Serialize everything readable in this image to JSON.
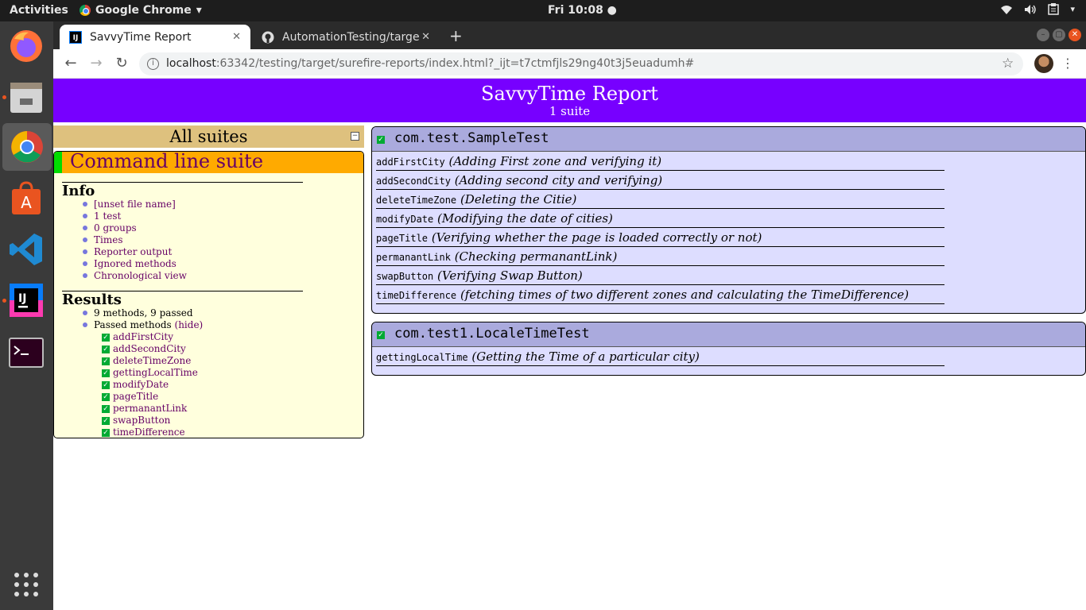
{
  "topbar": {
    "activities": "Activities",
    "app_name": "Google Chrome",
    "clock": "Fri 10:08 ●"
  },
  "dock": {
    "items": [
      "firefox",
      "files",
      "chrome",
      "software-center",
      "vscode",
      "intellij",
      "terminal",
      "show-apps"
    ]
  },
  "browser": {
    "tabs": [
      {
        "title": "SavvyTime Report",
        "active": true
      },
      {
        "title": "AutomationTesting/targe",
        "active": false
      }
    ],
    "url_host": "localhost",
    "url_path": ":63342/testing/target/surefire-reports/index.html?_ijt=t7ctmfjls29ng40t3j5euadumh#"
  },
  "report": {
    "title": "SavvyTime Report",
    "subtitle": "1 suite",
    "all_suites": "All suites",
    "suite_name": "Command line suite",
    "info_title": "Info",
    "info_links": [
      "[unset file name]",
      "1 test",
      "0 groups",
      "Times",
      "Reporter output",
      "Ignored methods",
      "Chronological view"
    ],
    "results_title": "Results",
    "results_summary": "9 methods, 9 passed",
    "passed_label": "Passed methods ",
    "hide_label": "(hide)",
    "passed_methods": [
      "addFirstCity",
      "addSecondCity",
      "deleteTimeZone",
      "gettingLocalTime",
      "modifyDate",
      "pageTitle",
      "permanantLink",
      "swapButton",
      "timeDifference"
    ]
  },
  "classes": [
    {
      "name": "com.test.SampleTest",
      "methods": [
        {
          "name": "addFirstCity",
          "desc": "(Adding First zone and verifying it)"
        },
        {
          "name": "addSecondCity",
          "desc": "(Adding second city and verifying)"
        },
        {
          "name": "deleteTimeZone",
          "desc": "(Deleting the Citie)"
        },
        {
          "name": "modifyDate",
          "desc": "(Modifying the date of cities)"
        },
        {
          "name": "pageTitle",
          "desc": "(Verifying whether the page is loaded correctly or not)"
        },
        {
          "name": "permanantLink",
          "desc": "(Checking permanantLink)"
        },
        {
          "name": "swapButton",
          "desc": "(Verifying Swap Button)"
        },
        {
          "name": "timeDifference",
          "desc": "(fetching times of two different zones and calculating the TimeDifference)"
        }
      ]
    },
    {
      "name": "com.test1.LocaleTimeTest",
      "methods": [
        {
          "name": "gettingLocalTime",
          "desc": "(Getting the Time of a particular city)"
        }
      ]
    }
  ]
}
